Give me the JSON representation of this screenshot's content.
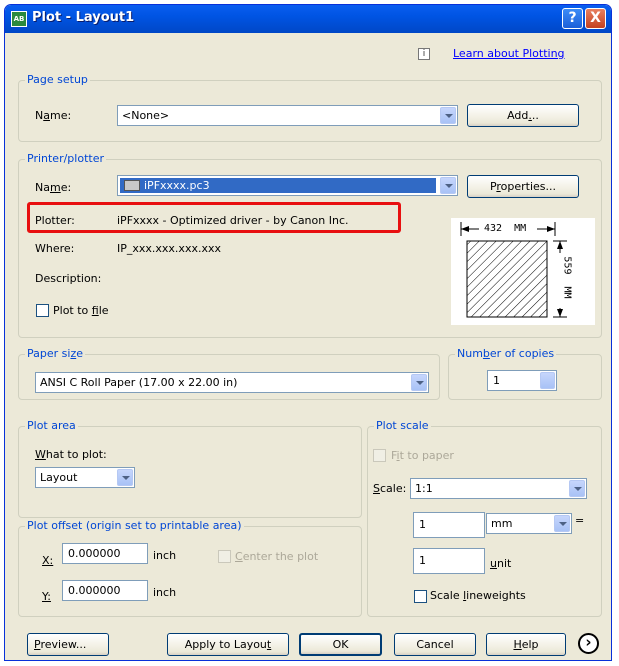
{
  "window": {
    "title": "Plot - Layout1",
    "help_btn": "?",
    "close_btn": "X"
  },
  "learn": {
    "icon": "i",
    "label": "Learn about Plotting"
  },
  "page_setup": {
    "legend": "Page setup",
    "name_label_pre": "N",
    "name_label_u": "a",
    "name_label_post": "me:",
    "name_value": "<None>",
    "add_pre": "Add",
    "add_u": ".",
    "add_post": ".."
  },
  "printer": {
    "legend": "Printer/plotter",
    "name_label_pre": "Na",
    "name_label_u": "m",
    "name_label_post": "e:",
    "name_value": "iPFxxxx.pc3",
    "properties_pre": "P",
    "properties_u": "r",
    "properties_post": "operties...",
    "plotter_label": "Plotter:",
    "plotter_value": "iPFxxxx - Optimized driver - by Canon Inc.",
    "where_label": "Where:",
    "where_value": "IP_xxx.xxx.xxx.xxx",
    "description_label": "Description:",
    "plot_to_file_pre": "Plot to ",
    "plot_to_file_u": "f",
    "plot_to_file_post": "ile",
    "preview_width": "432  MM",
    "preview_height": "559  MM",
    "highlight_color": "#e81010"
  },
  "paper_size": {
    "legend_pre": "Paper si",
    "legend_u": "z",
    "legend_post": "e",
    "value": "ANSI C Roll Paper (17.00 x 22.00 in)"
  },
  "copies": {
    "legend_pre": "Num",
    "legend_u": "b",
    "legend_post": "er of copies",
    "value": "1"
  },
  "plot_area": {
    "legend": "Plot area",
    "what_pre": "",
    "what_u": "W",
    "what_post": "hat to plot:",
    "value": "Layout"
  },
  "plot_offset": {
    "legend": "Plot offset (origin set to printable area)",
    "x_label": "X:",
    "x_value": "0.000000",
    "x_unit": "inch",
    "y_label": "Y:",
    "y_value": "0.000000",
    "y_unit": "inch",
    "center_pre": "",
    "center_u": "C",
    "center_post": "enter the plot"
  },
  "plot_scale": {
    "legend": "Plot scale",
    "fit_pre": "F",
    "fit_u": "i",
    "fit_post": "t to paper",
    "scale_pre": "",
    "scale_u": "S",
    "scale_post": "cale:",
    "scale_value": "1:1",
    "num_value": "1",
    "unit_value": "mm",
    "equals": "=",
    "den_value": "1",
    "den_unit_pre": "",
    "den_unit_u": "u",
    "den_unit_post": "nit",
    "lineweights_pre": "Scale ",
    "lineweights_u": "l",
    "lineweights_post": "ineweights"
  },
  "footer": {
    "preview_pre": "",
    "preview_u": "P",
    "preview_post": "review...",
    "apply_pre": "Apply to Layou",
    "apply_u": "t",
    "apply_post": "",
    "ok": "OK",
    "cancel": "Cancel",
    "help_pre": "",
    "help_u": "H",
    "help_post": "elp",
    "more_icon": "›"
  }
}
